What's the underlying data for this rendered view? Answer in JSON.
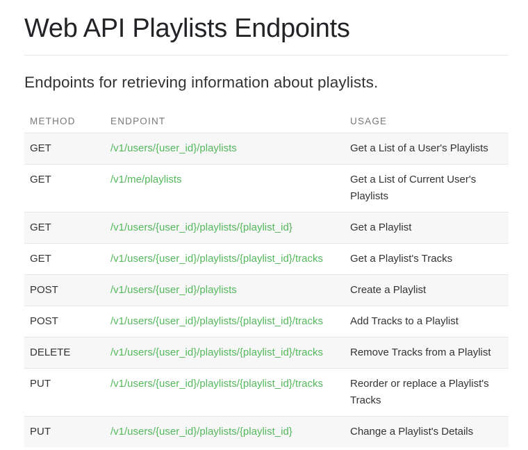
{
  "page": {
    "title": "Web API Playlists Endpoints",
    "lead": "Endpoints for retrieving information about playlists."
  },
  "table": {
    "headers": {
      "method": "METHOD",
      "endpoint": "ENDPOINT",
      "usage": "USAGE"
    },
    "rows": [
      {
        "method": "GET",
        "endpoint": "/v1/users/{user_id}/playlists",
        "usage": "Get a List of a User's Playlists"
      },
      {
        "method": "GET",
        "endpoint": "/v1/me/playlists",
        "usage": "Get a List of Current User's Playlists"
      },
      {
        "method": "GET",
        "endpoint": "/v1/users/{user_id}/playlists/{playlist_id}",
        "usage": "Get a Playlist"
      },
      {
        "method": "GET",
        "endpoint": "/v1/users/{user_id}/playlists/{playlist_id}/tracks",
        "usage": "Get a Playlist's Tracks"
      },
      {
        "method": "POST",
        "endpoint": "/v1/users/{user_id}/playlists",
        "usage": "Create a Playlist"
      },
      {
        "method": "POST",
        "endpoint": "/v1/users/{user_id}/playlists/{playlist_id}/tracks",
        "usage": "Add Tracks to a Playlist"
      },
      {
        "method": "DELETE",
        "endpoint": "/v1/users/{user_id}/playlists/{playlist_id}/tracks",
        "usage": "Remove Tracks from a Playlist"
      },
      {
        "method": "PUT",
        "endpoint": "/v1/users/{user_id}/playlists/{playlist_id}/tracks",
        "usage": "Reorder or replace a Playlist's Tracks"
      },
      {
        "method": "PUT",
        "endpoint": "/v1/users/{user_id}/playlists/{playlist_id}",
        "usage": "Change a Playlist's Details"
      }
    ]
  },
  "colors": {
    "link": "#54b85c",
    "row_stripe": "#f7f7f7",
    "header_text": "#777777"
  }
}
